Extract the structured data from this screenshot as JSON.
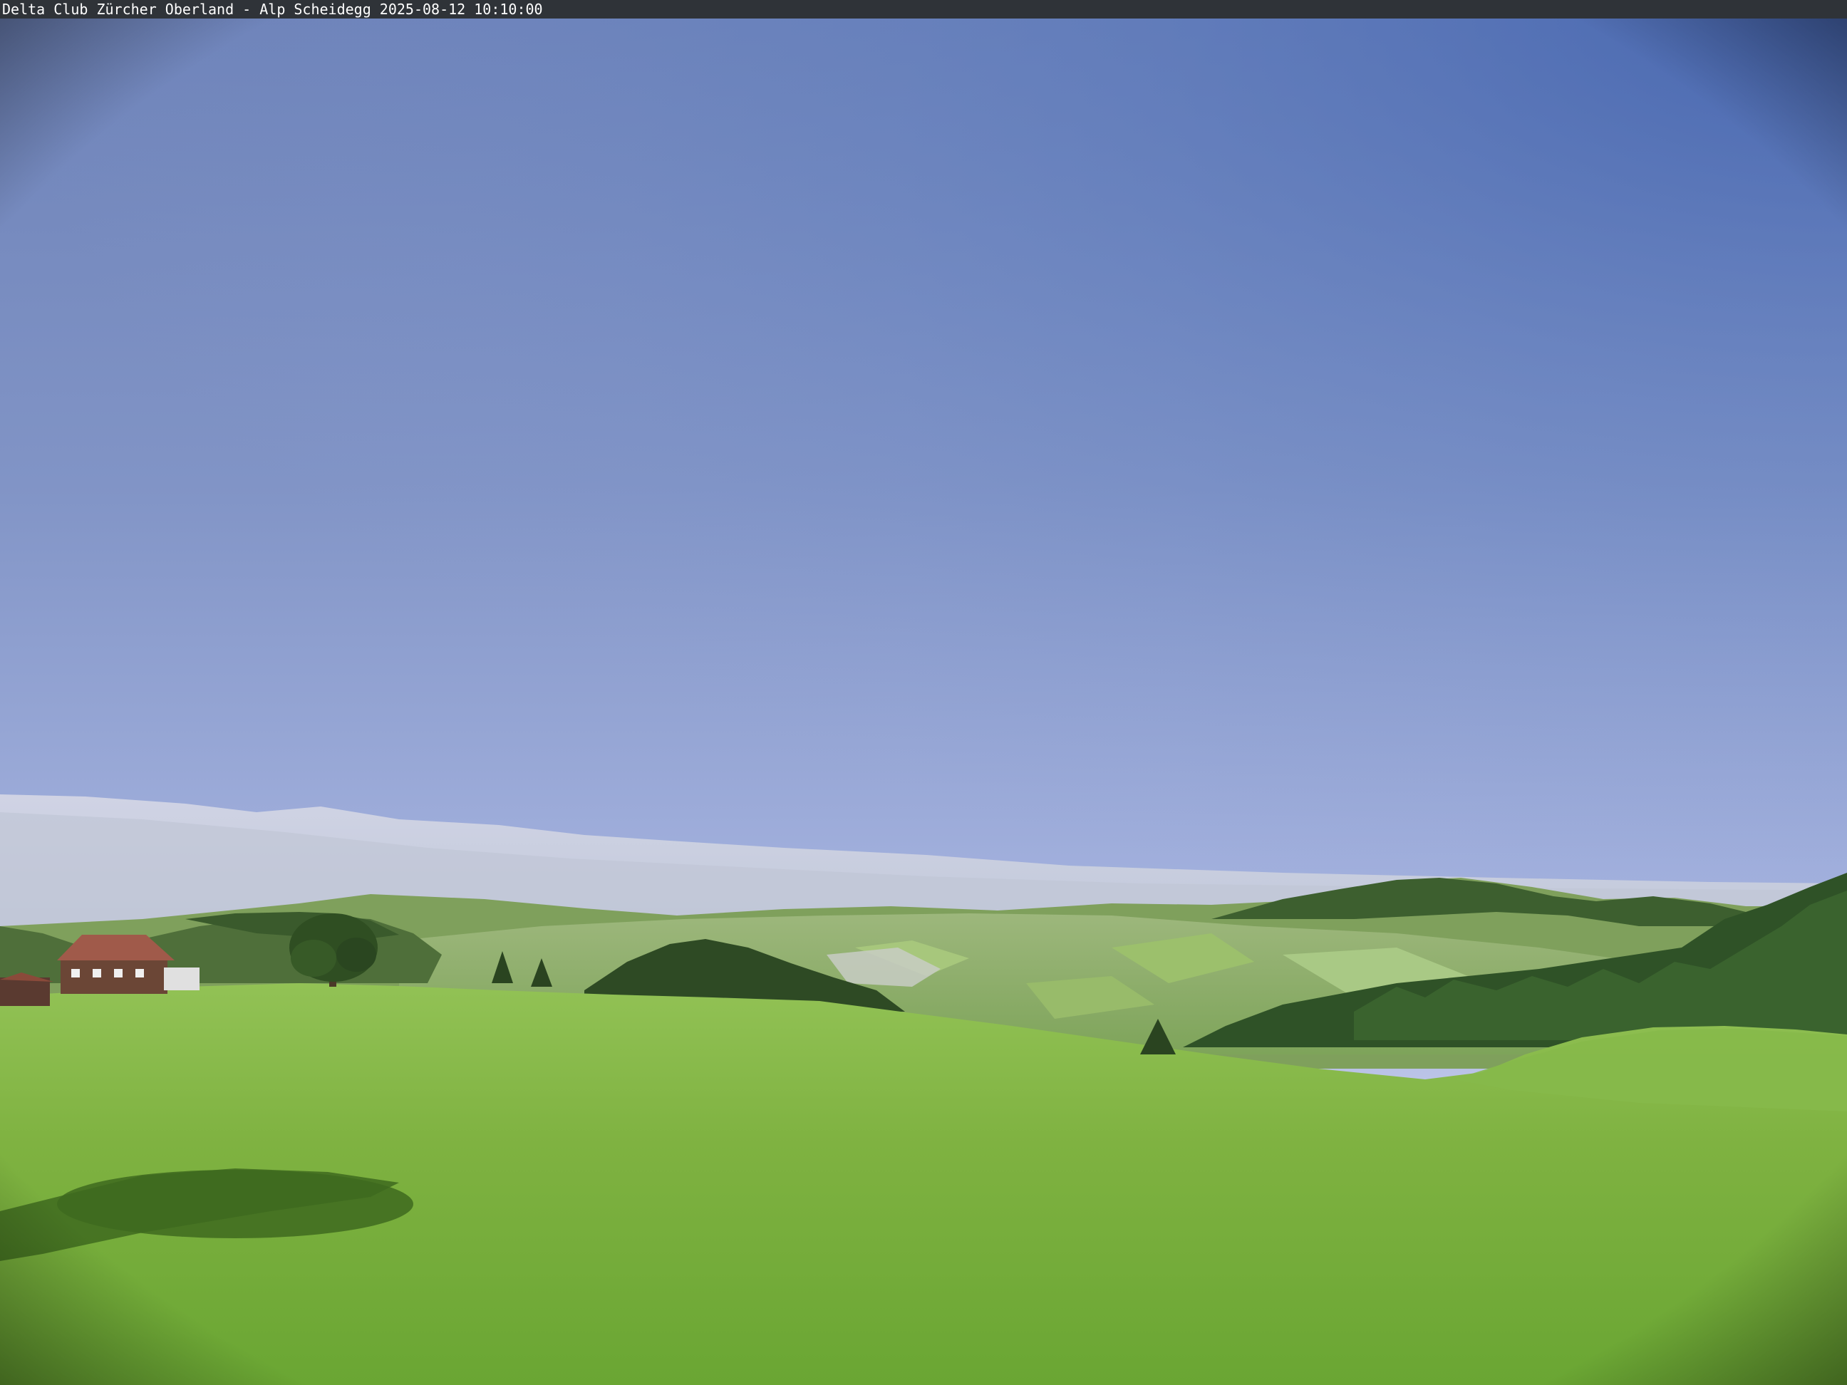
{
  "webcam": {
    "caption": "Delta Club Zürcher Oberland - Alp Scheidegg 2025-08-12 10:10:00"
  },
  "colors": {
    "sky_top": "#4f6db0",
    "sky_mid": "#8fa3d8",
    "sky_horizon": "#e6e4f2",
    "haze": "#c9cfdf",
    "meadow_light": "#8dbf4f",
    "meadow_dark": "#5f9a2e",
    "forest": "#2f4f24",
    "caption_bar": "#2f3338"
  }
}
